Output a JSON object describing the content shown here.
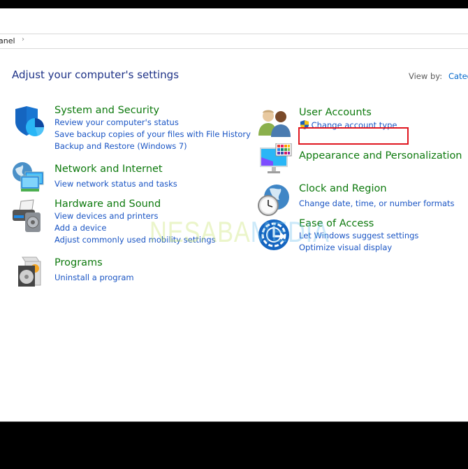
{
  "breadcrumb": {
    "current": "anel",
    "separator": "›"
  },
  "header": {
    "title": "Adjust your computer's settings",
    "view_by_label": "View by:",
    "view_by_value": "Category"
  },
  "categories_left": [
    {
      "icon": "shield-icon",
      "title": "System and Security",
      "links": [
        "Review your computer's status",
        "Save backup copies of your files with File History",
        "Backup and Restore (Windows 7)"
      ]
    },
    {
      "icon": "network-icon",
      "title": "Network and Internet",
      "links": [
        "View network status and tasks"
      ]
    },
    {
      "icon": "printer-speaker-icon",
      "title": "Hardware and Sound",
      "links": [
        "View devices and printers",
        "Add a device",
        "Adjust commonly used mobility settings"
      ]
    },
    {
      "icon": "programs-disc-icon",
      "title": "Programs",
      "links": [
        "Uninstall a program"
      ]
    }
  ],
  "categories_right": [
    {
      "icon": "users-icon",
      "title": "User Accounts",
      "links": [
        "Change account type"
      ]
    },
    {
      "icon": "monitor-palette-icon",
      "title": "Appearance and Personalization",
      "links": []
    },
    {
      "icon": "globe-clock-icon",
      "title": "Clock and Region",
      "links": [
        "Change date, time, or number formats"
      ]
    },
    {
      "icon": "ease-of-access-icon",
      "title": "Ease of Access",
      "links": [
        "Let Windows suggest settings",
        "Optimize visual display"
      ]
    }
  ],
  "watermark": {
    "part1": "NESABA",
    "part2": "MEDIA"
  },
  "colors": {
    "title_green": "#0e7a0e",
    "link_blue": "#1a55c4",
    "heading_blue": "#1e3287",
    "highlight_red": "#e0161f"
  }
}
